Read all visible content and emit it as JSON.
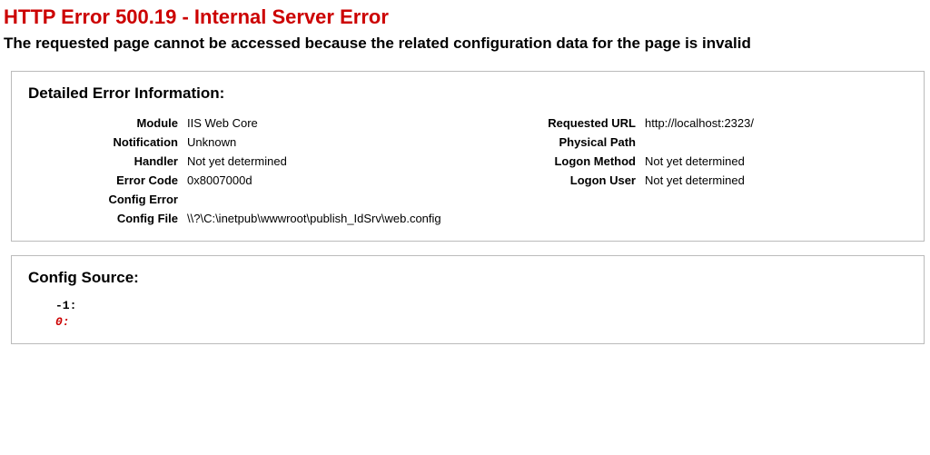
{
  "title": "HTTP Error 500.19 - Internal Server Error",
  "subtitle": "The requested page cannot be accessed because the related configuration data for the page is invalid",
  "detail_heading": "Detailed Error Information:",
  "left": {
    "module_label": "Module",
    "module_value": "IIS Web Core",
    "notification_label": "Notification",
    "notification_value": "Unknown",
    "handler_label": "Handler",
    "handler_value": "Not yet determined",
    "error_code_label": "Error Code",
    "error_code_value": "0x8007000d",
    "config_error_label": "Config Error",
    "config_error_value": "",
    "config_file_label": "Config File",
    "config_file_value": "\\\\?\\C:\\inetpub\\wwwroot\\publish_IdSrv\\web.config"
  },
  "right": {
    "requested_url_label": "Requested URL",
    "requested_url_value": "http://localhost:2323/",
    "physical_path_label": "Physical Path",
    "physical_path_value": "",
    "logon_method_label": "Logon Method",
    "logon_method_value": "Not yet determined",
    "logon_user_label": "Logon User",
    "logon_user_value": "Not yet determined"
  },
  "config_source_heading": "Config Source:",
  "config_source": {
    "line_neg1": "-1:",
    "line_0": " 0:"
  }
}
